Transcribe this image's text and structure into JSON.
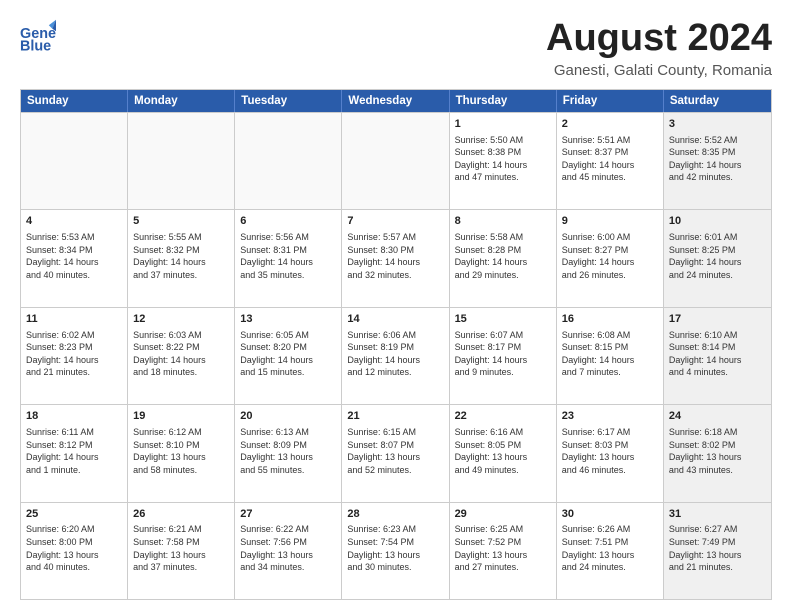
{
  "header": {
    "logo_general": "General",
    "logo_blue": "Blue",
    "main_title": "August 2024",
    "subtitle": "Ganesti, Galati County, Romania"
  },
  "calendar": {
    "days_of_week": [
      "Sunday",
      "Monday",
      "Tuesday",
      "Wednesday",
      "Thursday",
      "Friday",
      "Saturday"
    ],
    "rows": [
      [
        {
          "day": "",
          "empty": true
        },
        {
          "day": "",
          "empty": true
        },
        {
          "day": "",
          "empty": true
        },
        {
          "day": "",
          "empty": true
        },
        {
          "day": "1",
          "lines": [
            "Sunrise: 5:50 AM",
            "Sunset: 8:38 PM",
            "Daylight: 14 hours",
            "and 47 minutes."
          ]
        },
        {
          "day": "2",
          "lines": [
            "Sunrise: 5:51 AM",
            "Sunset: 8:37 PM",
            "Daylight: 14 hours",
            "and 45 minutes."
          ]
        },
        {
          "day": "3",
          "lines": [
            "Sunrise: 5:52 AM",
            "Sunset: 8:35 PM",
            "Daylight: 14 hours",
            "and 42 minutes."
          ],
          "shaded": true
        }
      ],
      [
        {
          "day": "4",
          "lines": [
            "Sunrise: 5:53 AM",
            "Sunset: 8:34 PM",
            "Daylight: 14 hours",
            "and 40 minutes."
          ]
        },
        {
          "day": "5",
          "lines": [
            "Sunrise: 5:55 AM",
            "Sunset: 8:32 PM",
            "Daylight: 14 hours",
            "and 37 minutes."
          ]
        },
        {
          "day": "6",
          "lines": [
            "Sunrise: 5:56 AM",
            "Sunset: 8:31 PM",
            "Daylight: 14 hours",
            "and 35 minutes."
          ]
        },
        {
          "day": "7",
          "lines": [
            "Sunrise: 5:57 AM",
            "Sunset: 8:30 PM",
            "Daylight: 14 hours",
            "and 32 minutes."
          ]
        },
        {
          "day": "8",
          "lines": [
            "Sunrise: 5:58 AM",
            "Sunset: 8:28 PM",
            "Daylight: 14 hours",
            "and 29 minutes."
          ]
        },
        {
          "day": "9",
          "lines": [
            "Sunrise: 6:00 AM",
            "Sunset: 8:27 PM",
            "Daylight: 14 hours",
            "and 26 minutes."
          ]
        },
        {
          "day": "10",
          "lines": [
            "Sunrise: 6:01 AM",
            "Sunset: 8:25 PM",
            "Daylight: 14 hours",
            "and 24 minutes."
          ],
          "shaded": true
        }
      ],
      [
        {
          "day": "11",
          "lines": [
            "Sunrise: 6:02 AM",
            "Sunset: 8:23 PM",
            "Daylight: 14 hours",
            "and 21 minutes."
          ]
        },
        {
          "day": "12",
          "lines": [
            "Sunrise: 6:03 AM",
            "Sunset: 8:22 PM",
            "Daylight: 14 hours",
            "and 18 minutes."
          ]
        },
        {
          "day": "13",
          "lines": [
            "Sunrise: 6:05 AM",
            "Sunset: 8:20 PM",
            "Daylight: 14 hours",
            "and 15 minutes."
          ]
        },
        {
          "day": "14",
          "lines": [
            "Sunrise: 6:06 AM",
            "Sunset: 8:19 PM",
            "Daylight: 14 hours",
            "and 12 minutes."
          ]
        },
        {
          "day": "15",
          "lines": [
            "Sunrise: 6:07 AM",
            "Sunset: 8:17 PM",
            "Daylight: 14 hours",
            "and 9 minutes."
          ]
        },
        {
          "day": "16",
          "lines": [
            "Sunrise: 6:08 AM",
            "Sunset: 8:15 PM",
            "Daylight: 14 hours",
            "and 7 minutes."
          ]
        },
        {
          "day": "17",
          "lines": [
            "Sunrise: 6:10 AM",
            "Sunset: 8:14 PM",
            "Daylight: 14 hours",
            "and 4 minutes."
          ],
          "shaded": true
        }
      ],
      [
        {
          "day": "18",
          "lines": [
            "Sunrise: 6:11 AM",
            "Sunset: 8:12 PM",
            "Daylight: 14 hours",
            "and 1 minute."
          ]
        },
        {
          "day": "19",
          "lines": [
            "Sunrise: 6:12 AM",
            "Sunset: 8:10 PM",
            "Daylight: 13 hours",
            "and 58 minutes."
          ]
        },
        {
          "day": "20",
          "lines": [
            "Sunrise: 6:13 AM",
            "Sunset: 8:09 PM",
            "Daylight: 13 hours",
            "and 55 minutes."
          ]
        },
        {
          "day": "21",
          "lines": [
            "Sunrise: 6:15 AM",
            "Sunset: 8:07 PM",
            "Daylight: 13 hours",
            "and 52 minutes."
          ]
        },
        {
          "day": "22",
          "lines": [
            "Sunrise: 6:16 AM",
            "Sunset: 8:05 PM",
            "Daylight: 13 hours",
            "and 49 minutes."
          ]
        },
        {
          "day": "23",
          "lines": [
            "Sunrise: 6:17 AM",
            "Sunset: 8:03 PM",
            "Daylight: 13 hours",
            "and 46 minutes."
          ]
        },
        {
          "day": "24",
          "lines": [
            "Sunrise: 6:18 AM",
            "Sunset: 8:02 PM",
            "Daylight: 13 hours",
            "and 43 minutes."
          ],
          "shaded": true
        }
      ],
      [
        {
          "day": "25",
          "lines": [
            "Sunrise: 6:20 AM",
            "Sunset: 8:00 PM",
            "Daylight: 13 hours",
            "and 40 minutes."
          ]
        },
        {
          "day": "26",
          "lines": [
            "Sunrise: 6:21 AM",
            "Sunset: 7:58 PM",
            "Daylight: 13 hours",
            "and 37 minutes."
          ]
        },
        {
          "day": "27",
          "lines": [
            "Sunrise: 6:22 AM",
            "Sunset: 7:56 PM",
            "Daylight: 13 hours",
            "and 34 minutes."
          ]
        },
        {
          "day": "28",
          "lines": [
            "Sunrise: 6:23 AM",
            "Sunset: 7:54 PM",
            "Daylight: 13 hours",
            "and 30 minutes."
          ]
        },
        {
          "day": "29",
          "lines": [
            "Sunrise: 6:25 AM",
            "Sunset: 7:52 PM",
            "Daylight: 13 hours",
            "and 27 minutes."
          ]
        },
        {
          "day": "30",
          "lines": [
            "Sunrise: 6:26 AM",
            "Sunset: 7:51 PM",
            "Daylight: 13 hours",
            "and 24 minutes."
          ]
        },
        {
          "day": "31",
          "lines": [
            "Sunrise: 6:27 AM",
            "Sunset: 7:49 PM",
            "Daylight: 13 hours",
            "and 21 minutes."
          ],
          "shaded": true
        }
      ]
    ]
  }
}
